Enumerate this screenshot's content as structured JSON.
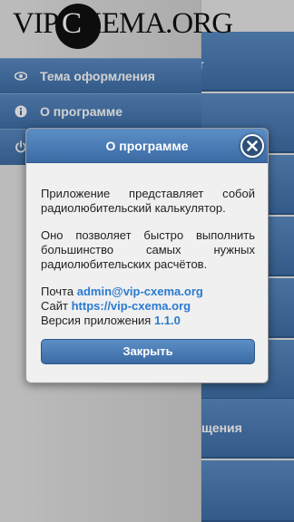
{
  "background": {
    "tile_labels": [
      "т",
      "щения"
    ]
  },
  "drawer": {
    "logo": {
      "prefix": "VIP",
      "circle_letter": "C",
      "suffix": "XEMA.ORG"
    },
    "items": [
      {
        "label": "Тема оформления",
        "icon": "eye-icon"
      },
      {
        "label": "О программе",
        "icon": "info-icon"
      },
      {
        "label": "",
        "icon": "power-icon"
      }
    ]
  },
  "dialog": {
    "title": "О программе",
    "paragraph1": "Приложение представляет собой радиолюбительский калькулятор.",
    "paragraph2": "Оно позволяет быстро выполнить большинство самых нужных радиолюбительских расчётов.",
    "email_label": "Почта",
    "email_value": "admin@vip-cxema.org",
    "site_label": "Сайт",
    "site_value": "https://vip-cxema.org",
    "version_label": "Версия приложения",
    "version_value": "1.1.0",
    "close_button": "Закрыть"
  },
  "colors": {
    "accent": "#3f6fa8",
    "link": "#2a7ad0"
  }
}
